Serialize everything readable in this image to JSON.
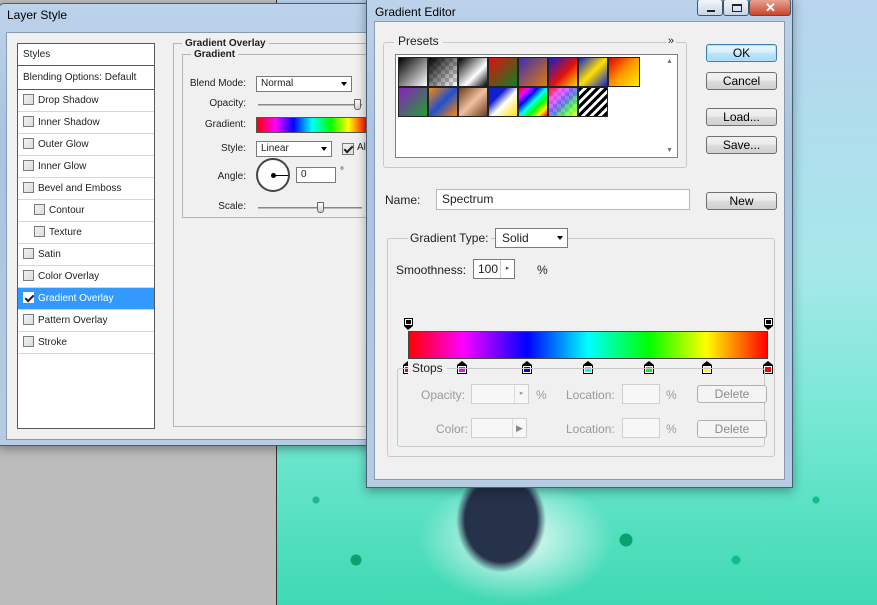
{
  "layer_style": {
    "title": "Layer Style",
    "styles_header": "Styles",
    "blending_options": "Blending Options: Default",
    "items": [
      {
        "label": "Drop Shadow",
        "checked": false,
        "sub": false
      },
      {
        "label": "Inner Shadow",
        "checked": false,
        "sub": false
      },
      {
        "label": "Outer Glow",
        "checked": false,
        "sub": false
      },
      {
        "label": "Inner Glow",
        "checked": false,
        "sub": false
      },
      {
        "label": "Bevel and Emboss",
        "checked": false,
        "sub": false
      },
      {
        "label": "Contour",
        "checked": false,
        "sub": true
      },
      {
        "label": "Texture",
        "checked": false,
        "sub": true
      },
      {
        "label": "Satin",
        "checked": false,
        "sub": false
      },
      {
        "label": "Color Overlay",
        "checked": false,
        "sub": false
      },
      {
        "label": "Gradient Overlay",
        "checked": true,
        "sub": false,
        "selected": true
      },
      {
        "label": "Pattern Overlay",
        "checked": false,
        "sub": false
      },
      {
        "label": "Stroke",
        "checked": false,
        "sub": false
      }
    ],
    "panel": {
      "section_title": "Gradient Overlay",
      "group_title": "Gradient",
      "blend_mode_label": "Blend Mode:",
      "blend_mode_value": "Normal",
      "opacity_label": "Opacity:",
      "gradient_label": "Gradient:",
      "style_label": "Style:",
      "style_value": "Linear",
      "align_label": "Ali",
      "angle_label": "Angle:",
      "angle_value": "0",
      "angle_unit": "°",
      "scale_label": "Scale:"
    }
  },
  "gradient_editor": {
    "title": "Gradient Editor",
    "presets_label": "Presets",
    "presets_menu_glyph": "»",
    "buttons": {
      "ok": "OK",
      "cancel": "Cancel",
      "load": "Load...",
      "save": "Save...",
      "new": "New"
    },
    "name_label": "Name:",
    "name_value": "Spectrum",
    "gradient_type_label": "Gradient Type:",
    "gradient_type_value": "Solid",
    "smoothness_label": "Smoothness:",
    "smoothness_value": "100",
    "smoothness_unit": "%",
    "stops": {
      "legend": "Stops",
      "opacity_label": "Opacity:",
      "opacity_unit": "%",
      "location_label": "Location:",
      "location_unit": "%",
      "color_label": "Color:",
      "delete": "Delete"
    },
    "color_stops": [
      "#ff0000",
      "#ff00ff",
      "#0000ff",
      "#00ffff",
      "#00ff00",
      "#ffff00",
      "#ff0000"
    ],
    "color_stop_locations": [
      0,
      15,
      33,
      50,
      67,
      83,
      100
    ],
    "opacity_stop_locations": [
      0,
      100
    ]
  }
}
